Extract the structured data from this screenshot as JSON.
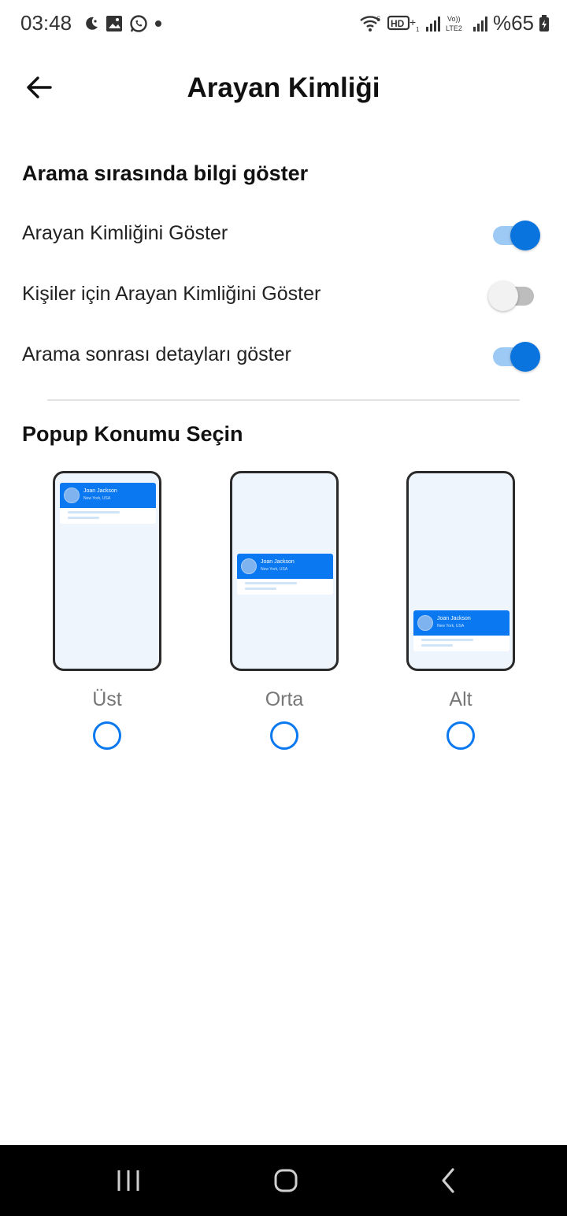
{
  "status_bar": {
    "time": "03:48",
    "battery": "%65",
    "left_icons": [
      "moon-icon",
      "image-icon",
      "whatsapp-icon",
      "dot-icon"
    ],
    "right_icons": [
      "wifi-icon",
      "hd-icon",
      "signal-icon",
      "volte-icon",
      "signal-icon",
      "battery-icon"
    ]
  },
  "header": {
    "title": "Arayan Kimliği",
    "back_icon": "arrow-left-icon"
  },
  "section_info": {
    "title": "Arama sırasında bilgi göster",
    "settings": [
      {
        "label": "Arayan Kimliğini Göster",
        "enabled": true
      },
      {
        "label": "Kişiler için Arayan Kimliğini Göster",
        "enabled": false
      },
      {
        "label": "Arama sonrası detayları göster",
        "enabled": true
      }
    ]
  },
  "section_popup": {
    "title": "Popup Konumu Seçin",
    "preview_name": "Joan Jackson",
    "preview_place": "New York, USA",
    "options": [
      {
        "label": "Üst",
        "selected": false
      },
      {
        "label": "Orta",
        "selected": false
      },
      {
        "label": "Alt",
        "selected": false
      }
    ]
  },
  "colors": {
    "accent": "#0a78f0",
    "toggle_on_track": "#9ccaf5",
    "toggle_off_track": "#bdbdbd",
    "preview_bg": "#eef5fc"
  },
  "nav_bar": {
    "icons": [
      "recent-apps-icon",
      "home-icon",
      "back-icon"
    ]
  }
}
